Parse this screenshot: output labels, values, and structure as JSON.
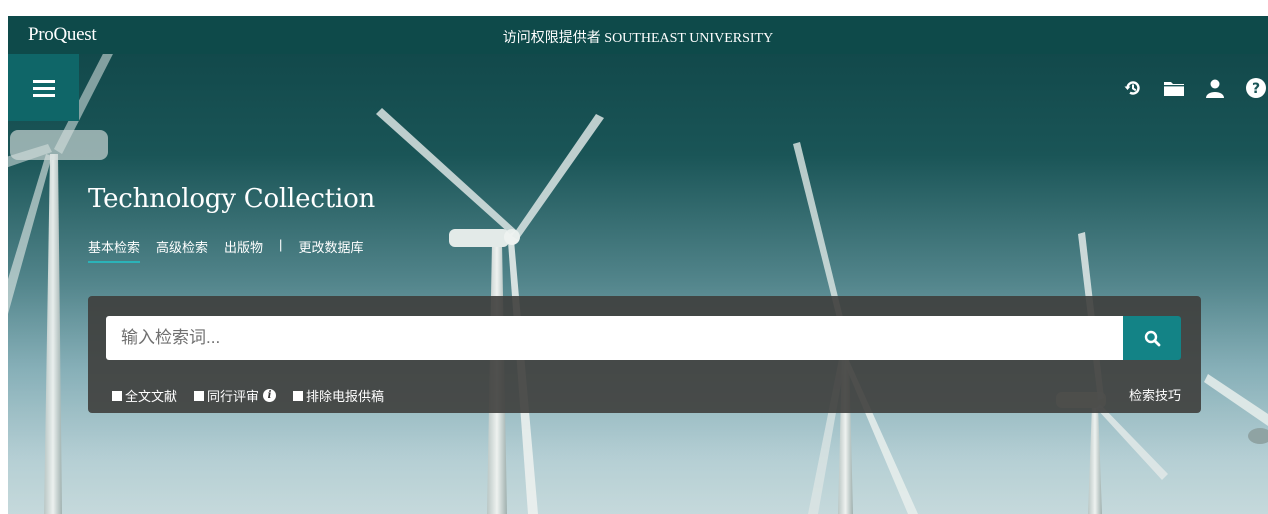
{
  "topbar": {
    "brand": "ProQuest",
    "access_text": "访问权限提供者 SOUTHEAST UNIVERSITY"
  },
  "toolbar": {
    "icons": [
      "history-icon",
      "folder-icon",
      "user-icon",
      "help-icon"
    ]
  },
  "collection": {
    "title": "Technology Collection"
  },
  "nav": {
    "basic_search": "基本检索",
    "advanced_search": "高级检索",
    "publications": "出版物",
    "separator": "|",
    "change_databases": "更改数据库"
  },
  "search": {
    "placeholder": "输入检索词...",
    "value": ""
  },
  "options": {
    "full_text": "全文文献",
    "peer_reviewed": "同行评审",
    "exclude_wire": "排除电报供稿"
  },
  "search_tips": "检索技巧",
  "colors": {
    "topbar": "#0e4a4a",
    "menu_button": "#0f6668",
    "search_button": "#138386",
    "active_tab_underline": "#2bb3b8"
  }
}
